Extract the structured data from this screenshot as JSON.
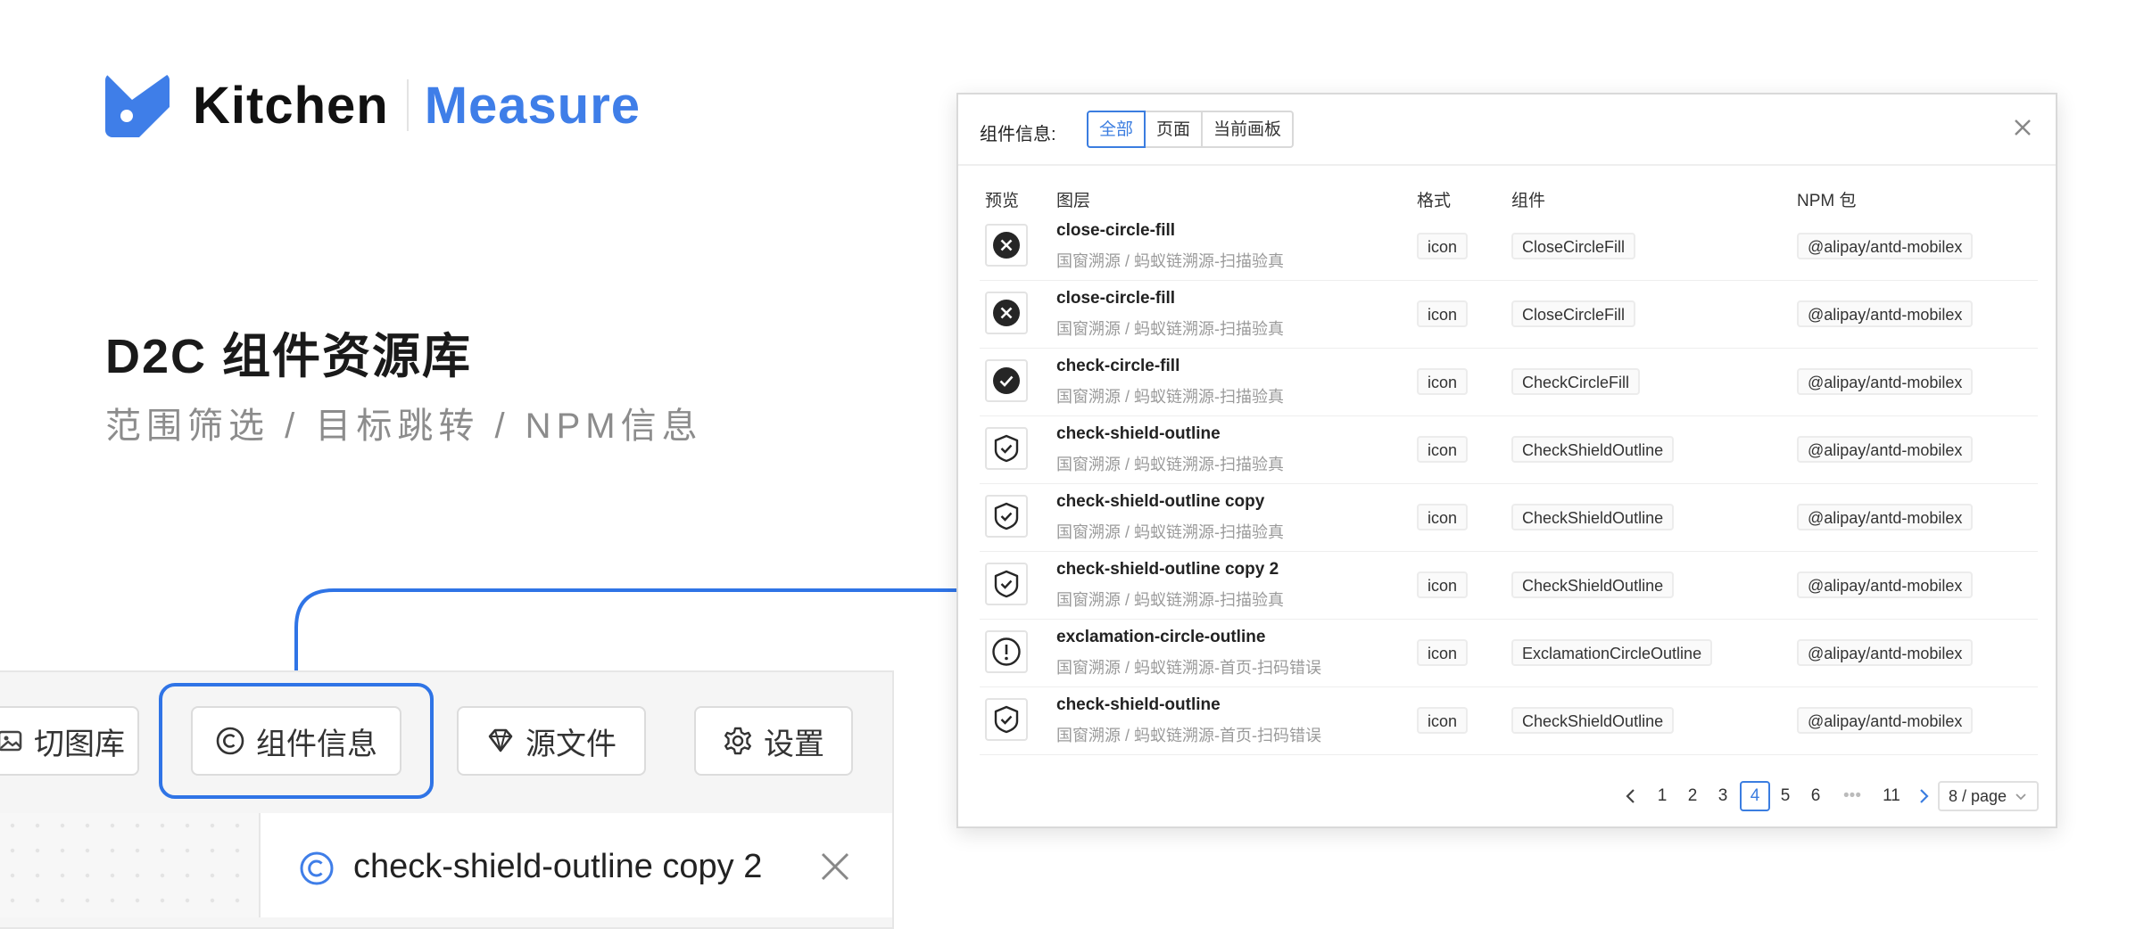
{
  "brand": {
    "name": "Kitchen",
    "product": "Measure",
    "colors": {
      "primary": "#3f7ee8",
      "dark": "#111111"
    }
  },
  "headline": "D2C 组件资源库",
  "subline": "范围筛选 / 目标跳转 / NPM信息",
  "toolbar": {
    "buttons": [
      {
        "label": "切图库",
        "icon": "image-icon"
      },
      {
        "label": "组件信息",
        "icon": "copyright-icon"
      },
      {
        "label": "源文件",
        "icon": "diamond-icon"
      },
      {
        "label": "设置",
        "icon": "gear-icon"
      }
    ],
    "selected": "组件信息"
  },
  "detail": {
    "title": "check-shield-outline copy 2",
    "icon": "copyright-icon"
  },
  "dialog": {
    "label": "组件信息:",
    "filters": [
      "全部",
      "页面",
      "当前画板"
    ],
    "active_filter": "全部",
    "columns": [
      "预览",
      "图层",
      "格式",
      "组件",
      "NPM 包"
    ],
    "rows": [
      {
        "icon": "close-circle-fill",
        "name": "close-circle-fill",
        "path": "国窗溯源 / 蚂蚁链溯源-扫描验真",
        "format": "icon",
        "component": "CloseCircleFill",
        "npm": "@alipay/antd-mobilex"
      },
      {
        "icon": "close-circle-fill",
        "name": "close-circle-fill",
        "path": "国窗溯源 / 蚂蚁链溯源-扫描验真",
        "format": "icon",
        "component": "CloseCircleFill",
        "npm": "@alipay/antd-mobilex"
      },
      {
        "icon": "check-circle-fill",
        "name": "check-circle-fill",
        "path": "国窗溯源 / 蚂蚁链溯源-扫描验真",
        "format": "icon",
        "component": "CheckCircleFill",
        "npm": "@alipay/antd-mobilex"
      },
      {
        "icon": "check-shield-outline",
        "name": "check-shield-outline",
        "path": "国窗溯源 / 蚂蚁链溯源-扫描验真",
        "format": "icon",
        "component": "CheckShieldOutline",
        "npm": "@alipay/antd-mobilex"
      },
      {
        "icon": "check-shield-outline",
        "name": "check-shield-outline copy",
        "path": "国窗溯源 / 蚂蚁链溯源-扫描验真",
        "format": "icon",
        "component": "CheckShieldOutline",
        "npm": "@alipay/antd-mobilex"
      },
      {
        "icon": "check-shield-outline",
        "name": "check-shield-outline copy 2",
        "path": "国窗溯源 / 蚂蚁链溯源-扫描验真",
        "format": "icon",
        "component": "CheckShieldOutline",
        "npm": "@alipay/antd-mobilex"
      },
      {
        "icon": "exclamation-circle-outline",
        "name": "exclamation-circle-outline",
        "path": "国窗溯源 / 蚂蚁链溯源-首页-扫码错误",
        "format": "icon",
        "component": "ExclamationCircleOutline",
        "npm": "@alipay/antd-mobilex"
      },
      {
        "icon": "check-shield-outline",
        "name": "check-shield-outline",
        "path": "国窗溯源 / 蚂蚁链溯源-首页-扫码错误",
        "format": "icon",
        "component": "CheckShieldOutline",
        "npm": "@alipay/antd-mobilex"
      }
    ],
    "pagination": {
      "pages": [
        "1",
        "2",
        "3",
        "4",
        "5",
        "6",
        "•••",
        "11"
      ],
      "current": "4",
      "page_size": "8 / page"
    }
  }
}
